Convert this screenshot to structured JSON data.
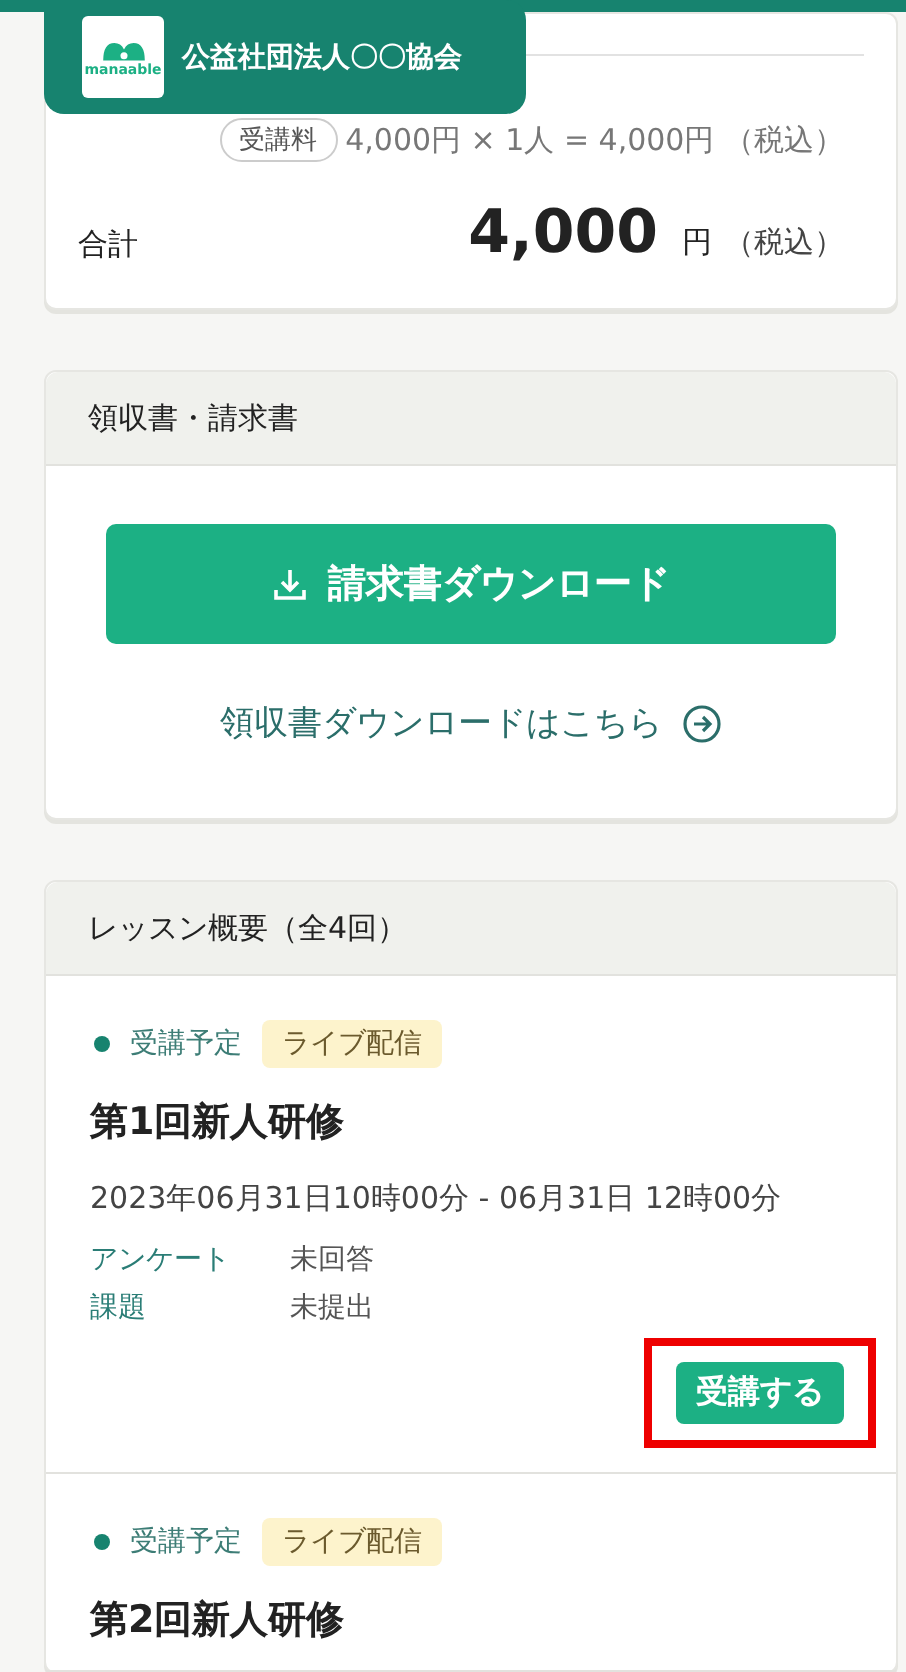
{
  "header": {
    "logo_text": "manaable",
    "org_name": "公益社団法人〇〇協会"
  },
  "fee_card": {
    "fee_tag": "受講料",
    "fee_formula": "4,000円 × 1人 = 4,000円 （税込）",
    "total_label": "合計",
    "total_amount": "4,000",
    "total_unit": "円",
    "total_tax": "（税込）"
  },
  "documents_card": {
    "title": "領収書・請求書",
    "invoice_button": "請求書ダウンロード",
    "receipt_link": "領収書ダウンロードはこちら"
  },
  "lessons_card": {
    "title": "レッスン概要（全4回）",
    "lessons": [
      {
        "status": "受講予定",
        "color": "#17836f",
        "delivery_tag": "ライブ配信",
        "title": "第1回新人研修",
        "datetime": "2023年06月31日10時00分 - 06月31日 12時00分",
        "details": [
          {
            "label": "アンケート",
            "value": "未回答"
          },
          {
            "label": "課題",
            "value": "未提出"
          }
        ],
        "action": {
          "label": "受講する",
          "highlighted": true
        }
      },
      {
        "status": "受講予定",
        "color": "#17836f",
        "delivery_tag": "ライブ配信",
        "title": "第2回新人研修"
      }
    ]
  }
}
